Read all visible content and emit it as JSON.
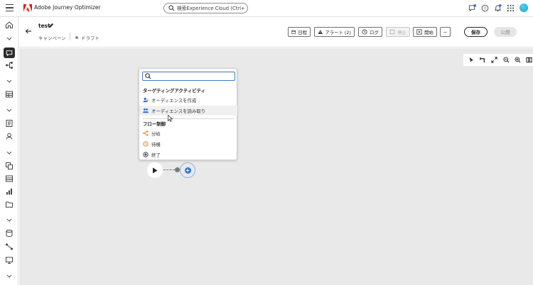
{
  "app": {
    "title": "Adobe Journey Optimizer"
  },
  "search": {
    "placeholder": "検索Experience Cloud (Ctrl+/)"
  },
  "campaign": {
    "title": "test",
    "type": "キャンペーン",
    "status": "ドラフト"
  },
  "actions": {
    "schedule": "日程",
    "alerts": "アラート (2)",
    "log": "ログ",
    "stop": "停止",
    "start": "開始",
    "save": "保存",
    "publish": "公開"
  },
  "popover": {
    "search_placeholder": "",
    "sections": [
      {
        "title": "ターゲティングアクティビティ",
        "items": [
          {
            "label": "オーディエンスを作成",
            "icon": "build-audience-icon"
          },
          {
            "label": "オーディエンスを読み取り",
            "icon": "read-audience-icon"
          }
        ]
      },
      {
        "title": "フロー制御",
        "items": [
          {
            "label": "分岐",
            "icon": "fork-icon"
          },
          {
            "label": "待機",
            "icon": "wait-icon"
          },
          {
            "label": "終了",
            "icon": "end-icon"
          }
        ]
      }
    ]
  },
  "colors": {
    "accent": "#2f74d0",
    "avatar": "#1aa3c6",
    "logo": "#eb1000"
  }
}
